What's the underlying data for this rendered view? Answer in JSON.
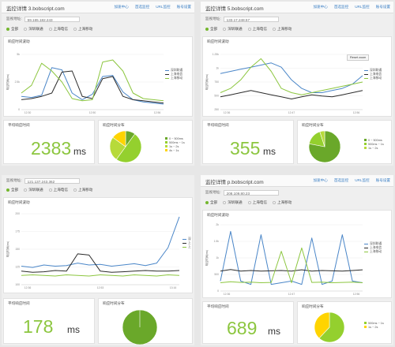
{
  "panels": [
    {
      "title": "监控详情 3.bobscript.com",
      "nav": [
        "加速中心",
        "首选监控",
        "URL监控",
        "账号设置"
      ],
      "address_label": "监视地址:",
      "address_ip": "59.165.182.243",
      "filters": [
        "全部",
        "深圳联通",
        "上海电信",
        "上海移动"
      ],
      "trend_title": "响应时间波动",
      "trend_ylabel": "响应时间(ms)",
      "x_ticks": [
        "12:30",
        "12:50",
        "12:56"
      ],
      "y_ticks": [
        "5k",
        "2.5k",
        "0"
      ],
      "series_names": [
        "深圳联通",
        "上海电信",
        "上海移动"
      ],
      "avg_title": "平均响应时间",
      "avg_value": "2383",
      "avg_unit": "ms",
      "dist_title": "响应时间分布",
      "dist_legend": [
        "0 ~ 500ms",
        "500ms ~ 1s",
        "1s ~ 2s",
        "4s ~ 1s"
      ],
      "dist_values": [
        0.1,
        0.5,
        0.25,
        0.15
      ],
      "reset_zoom": ""
    },
    {
      "title": "监控详情 5.bobscript.com",
      "nav": [
        "加速中心",
        "首选监控",
        "URL监控",
        "账号设置"
      ],
      "address_label": "监视地址:",
      "address_ip": "133.17.248.57",
      "filters": [
        "全部",
        "深圳联通",
        "上海电信",
        "上海移动"
      ],
      "trend_title": "响应时间波动",
      "trend_ylabel": "响应时间(ms)",
      "x_ticks": [
        "12:36",
        "12:47",
        "12:56"
      ],
      "y_ticks": [
        "1.25k",
        "1k",
        "750",
        "500",
        "250"
      ],
      "series_names": [
        "深圳联通",
        "上海电信",
        "上海移动"
      ],
      "avg_title": "平均响应时间",
      "avg_value": "355",
      "avg_unit": "ms",
      "dist_title": "响应时间分布",
      "dist_legend": [
        "0 ~ 500ms",
        "500ms ~ 1s",
        "1s ~ 2s"
      ],
      "dist_values": [
        0.78,
        0.17,
        0.05
      ],
      "reset_zoom": "Reset zoom"
    },
    {
      "title": "",
      "nav": [],
      "address_label": "监视地址:",
      "address_ip": "121.137.243.362",
      "filters": [
        "全部",
        "深圳联通",
        "上海电信",
        "上海移动"
      ],
      "trend_title": "响应时间波动",
      "trend_ylabel": "响应时间(ms)",
      "x_ticks": [
        "12:36",
        "12:53",
        "13:16"
      ],
      "y_ticks": [
        "200",
        "175",
        "150",
        "125",
        "100"
      ],
      "series_names": [
        "深",
        "上",
        "上"
      ],
      "avg_title": "平均响应时间",
      "avg_value": "178",
      "avg_unit": "ms",
      "dist_title": "响应时间分布",
      "dist_legend": [],
      "dist_values": [
        1.0
      ],
      "reset_zoom": ""
    },
    {
      "title": "监控详情 p.bobscript.com",
      "nav": [
        "加速中心",
        "首选监控",
        "URL监控",
        "账号设置"
      ],
      "address_label": "监视地址:",
      "address_ip": "208.109.80.23",
      "filters": [
        "全部",
        "深圳联通",
        "上海电信",
        "上海移动"
      ],
      "trend_title": "响应时间波动",
      "trend_ylabel": "响应时间(ms)",
      "x_ticks": [
        "12:36",
        "12:47",
        "12:56"
      ],
      "y_ticks": [
        "2k",
        "1.5k",
        "1k",
        "500",
        "0"
      ],
      "series_names": [
        "深圳联通",
        "上海电信",
        "上海移动"
      ],
      "avg_title": "平均响应时间",
      "avg_value": "689",
      "avg_unit": "ms",
      "dist_title": "响应时间分布",
      "dist_legend": [
        "500ms ~ 1s",
        "1s ~ 2s"
      ],
      "dist_values": [
        0.62,
        0.38
      ],
      "reset_zoom": ""
    }
  ],
  "colors": {
    "series": [
      "#4a86c8",
      "#2b2b2b",
      "#8cc63f"
    ],
    "pie": [
      "#6aa82a",
      "#94d02e",
      "#b7da3a",
      "#ffd400"
    ],
    "accent_green": "#8cc63f",
    "nav_blue": "#3b7fc4"
  },
  "chart_data": [
    {
      "type": "line",
      "ylabel": "响应时间(ms)",
      "x": [
        "12:30",
        "12:50",
        "12:56"
      ],
      "series": [
        {
          "name": "深圳联通",
          "values": [
            1200,
            1100,
            1300,
            3800,
            3600,
            1500,
            900,
            1400,
            3000,
            3100,
            1600,
            900,
            700,
            600,
            500
          ]
        },
        {
          "name": "上海电信",
          "values": [
            900,
            1000,
            1200,
            1500,
            3400,
            3500,
            1200,
            1000,
            2800,
            3000,
            1200,
            900,
            800,
            700,
            600
          ]
        },
        {
          "name": "上海移动",
          "values": [
            1500,
            2200,
            4200,
            3500,
            2500,
            1000,
            800,
            900,
            4300,
            4500,
            3500,
            1500,
            1000,
            900,
            800
          ]
        }
      ]
    },
    {
      "type": "line",
      "ylabel": "响应时间(ms)",
      "x": [
        "12:36",
        "12:47",
        "12:56"
      ],
      "series": [
        {
          "name": "深圳联通",
          "values": [
            850,
            900,
            950,
            1000,
            1050,
            1100,
            1000,
            700,
            500,
            400,
            400,
            450,
            500,
            600,
            800
          ]
        },
        {
          "name": "上海电信",
          "values": [
            300,
            350,
            400,
            450,
            400,
            350,
            300,
            250,
            300,
            350,
            320,
            300,
            350,
            400,
            450
          ]
        },
        {
          "name": "上海移动",
          "values": [
            400,
            500,
            700,
            1000,
            1200,
            900,
            500,
            400,
            350,
            400,
            450,
            500,
            550,
            600,
            650
          ]
        }
      ]
    },
    {
      "type": "line",
      "ylabel": "响应时间(ms)",
      "x": [
        "12:36",
        "12:53",
        "13:16"
      ],
      "series": [
        {
          "name": "深",
          "values": [
            120,
            118,
            122,
            120,
            121,
            125,
            122,
            123,
            120,
            122,
            124,
            121,
            125,
            150,
            200
          ]
        },
        {
          "name": "上",
          "values": [
            112,
            110,
            111,
            113,
            112,
            140,
            138,
            112,
            110,
            111,
            112,
            113,
            112,
            112,
            113
          ]
        },
        {
          "name": "上",
          "values": [
            105,
            106,
            105,
            104,
            106,
            105,
            104,
            106,
            105,
            104,
            106,
            105,
            104,
            106,
            105
          ]
        }
      ]
    },
    {
      "type": "line",
      "ylabel": "响应时间(ms)",
      "x": [
        "12:36",
        "12:47",
        "12:56"
      ],
      "series": [
        {
          "name": "深圳联通",
          "values": [
            300,
            1800,
            300,
            200,
            1700,
            200,
            250,
            300,
            200,
            1600,
            200,
            300,
            1700,
            300,
            250
          ]
        },
        {
          "name": "上海电信",
          "values": [
            600,
            650,
            600,
            620,
            600,
            610,
            620,
            600,
            640,
            600,
            620,
            610,
            600,
            620,
            640
          ]
        },
        {
          "name": "上海移动",
          "values": [
            250,
            280,
            260,
            270,
            250,
            260,
            1200,
            250,
            1300,
            260,
            270,
            250,
            260,
            270,
            250
          ]
        }
      ]
    }
  ]
}
